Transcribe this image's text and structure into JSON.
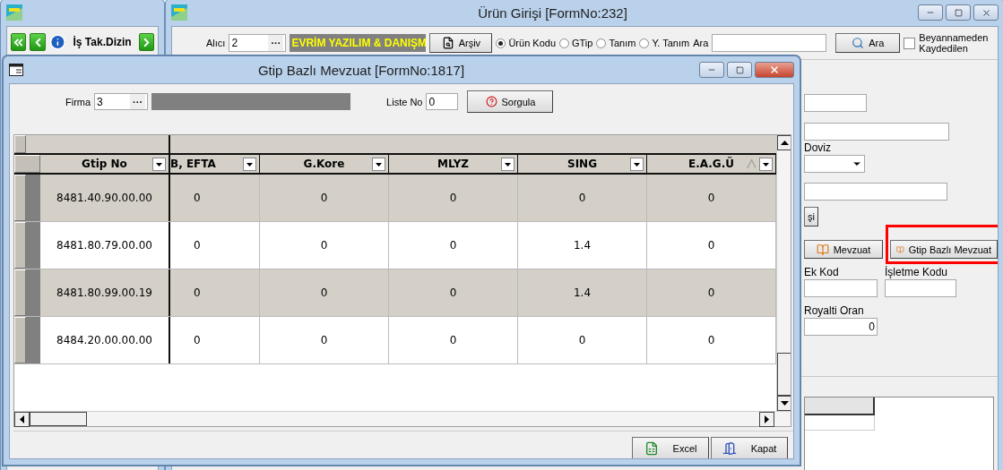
{
  "left_window": {
    "toolbar_label": "İş Tak.Dizin"
  },
  "main_window": {
    "title": "Ürün Girişi [FormNo:232]",
    "toolbar": {
      "buyer_label": "Alıcı",
      "buyer_value": "2",
      "lookup_button": "···",
      "company_name": "EVRİM YAZILIM & DANIŞM",
      "archive_button": "Arşiv",
      "search_options": [
        {
          "label": "Ürün Kodu",
          "selected": true
        },
        {
          "label": "GTip",
          "selected": false
        },
        {
          "label": "Tanım",
          "selected": false
        },
        {
          "label": "Y. Tanım",
          "selected": false
        }
      ],
      "search_label": "Ara",
      "search_button": "Ara",
      "saved_checkbox": {
        "label": "Beyannameden Kaydedilen",
        "checked": false
      }
    },
    "form": {
      "currency_label": "Doviz",
      "partial_button": "şi",
      "regulation_button": "Mevzuat",
      "gtip_regulation_button": "Gtip Bazlı Mevzuat",
      "extra_code_label": "Ek Kod",
      "business_code_label": "İşletme Kodu",
      "royalty_label": "Royalti Oran",
      "royalty_value": "0"
    }
  },
  "dialog": {
    "title": "Gtip Bazlı Mevzuat [FormNo:1817]",
    "company_label": "Firma",
    "company_value": "3",
    "lookup_button": "···",
    "list_label": "Liste No",
    "list_value": "0",
    "query_button": "Sorgula",
    "grid": {
      "columns": [
        {
          "label": "Gtip No",
          "sort_icon": false
        },
        {
          "label": "B, EFTA",
          "sort_icon": false
        },
        {
          "label": "G.Kore",
          "sort_icon": false
        },
        {
          "label": "MLYZ",
          "sort_icon": false
        },
        {
          "label": "SING",
          "sort_icon": false
        },
        {
          "label": "E.A.G.Ü",
          "sort_icon": true
        }
      ],
      "rows": [
        {
          "cells": [
            "8481.40.90.00.00",
            "0",
            "0",
            "0",
            "0",
            "0"
          ]
        },
        {
          "cells": [
            "8481.80.79.00.00",
            "0",
            "0",
            "0",
            "1.4",
            "0"
          ]
        },
        {
          "cells": [
            "8481.80.99.00.19",
            "0",
            "0",
            "0",
            "1.4",
            "0"
          ]
        },
        {
          "cells": [
            "8484.20.00.00.00",
            "0",
            "0",
            "0",
            "0",
            "0"
          ]
        }
      ]
    },
    "buttons": [
      {
        "kind": "excel",
        "label": "Excel"
      },
      {
        "kind": "close",
        "label": "Kapat"
      }
    ]
  }
}
